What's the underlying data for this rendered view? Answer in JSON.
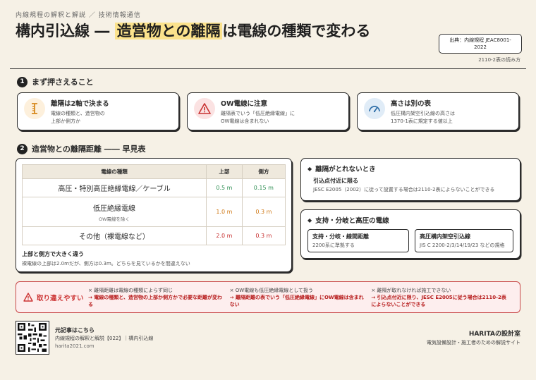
{
  "header": {
    "series": "内線規程の解釈と解説 ／ 技術情報通信",
    "title_main": "構内引込線 ― ",
    "title_highlight": "造営物との離隔",
    "title_rest": "は電線の種類で変わる",
    "source_line1": "出典：内線規程 JEAC8001-",
    "source_line2": "2022",
    "source_sub": "2110-2表の読み方"
  },
  "section1": {
    "num": "1",
    "title": "まず押さえること",
    "cards": [
      {
        "icon": "ruler-icon",
        "title": "離隔は2軸で決まる",
        "line1": "電線の種類と、造営物の",
        "line2": "上部か側方か",
        "color": "#d78a1e",
        "bg": "#fdf0dc"
      },
      {
        "icon": "warning-icon",
        "title": "OW電線に注意",
        "line1": "離隔表でいう「低圧絶縁電線」に",
        "line2": "OW電線は含まれない",
        "color": "#c83232",
        "bg": "#fbe2e2"
      },
      {
        "icon": "gauge-icon",
        "title": "高さは別の表",
        "line1": "低圧構内架空引込線の高さは",
        "line2": "1370-1表に規定する値以上",
        "color": "#2f6fa8",
        "bg": "#e0ecf7"
      }
    ]
  },
  "section2": {
    "num": "2",
    "title": "造営物との離隔距離 ―― 早見表",
    "table": {
      "headers": [
        "電線の種類",
        "上部",
        "側方"
      ],
      "rows": [
        {
          "type": "高圧・特別高圧絶縁電線／ケーブル",
          "sub": "",
          "top": "0.5 m",
          "side": "0.15 m",
          "cls": "val-g"
        },
        {
          "type": "低圧絶縁電線",
          "sub": "OW電線を除く",
          "top": "1.0 m",
          "side": "0.3 m",
          "cls": "val-o"
        },
        {
          "type": "その他（裸電線など）",
          "sub": "",
          "top": "2.0 m",
          "side": "0.3 m",
          "cls": "val-r"
        }
      ]
    },
    "note_title": "上部と側方で大きく違う",
    "note_body": "裸電線の上部は2.0mだが、側方は0.3m。どちらを見ているかを間違えない"
  },
  "side1": {
    "title": "離隔がとれないとき",
    "inner_title": "引込点付近に限る",
    "inner_body": "JESC E2005（2002）に従って設置する場合は2110-2表によらないことができる"
  },
  "side2": {
    "title": "支持・分岐と高圧の電線",
    "box1_title": "支持・分岐・線間距離",
    "box1_body": "2200系に準拠する",
    "box2_title": "高圧構内架空引込線",
    "box2_body": "JIS C 2200-2/3/14/19/23 などの規格"
  },
  "warning": {
    "label": "取り違えやすい",
    "items": [
      {
        "x": "× 離隔距離は電線の種類によらず同じ",
        "c": "→ 電線の種類と、造営物の上部か側方かで必要な距離が変わる"
      },
      {
        "x": "× OW電線も低圧絶縁電線として扱う",
        "c": "→ 離隔距離の表でいう「低圧絶縁電線」にOW電線は含まれない"
      },
      {
        "x": "× 離隔が取れなければ施工できない",
        "c": "→ 引込点付近に限り、JESC E2005に従う場合は2110-2表によらないことができる"
      }
    ]
  },
  "footer": {
    "title": "元記事はこちら",
    "sub": "内線規程の解釈と解説【022】｜構内引込線",
    "url": "harita2021.com",
    "brand": "HARITAの設計室",
    "brand_sub": "電気設備設計・施工者のための解説サイト"
  },
  "colors": {
    "accent": "#fbe28c",
    "danger": "#c83232",
    "ink": "#2b2b2b"
  }
}
